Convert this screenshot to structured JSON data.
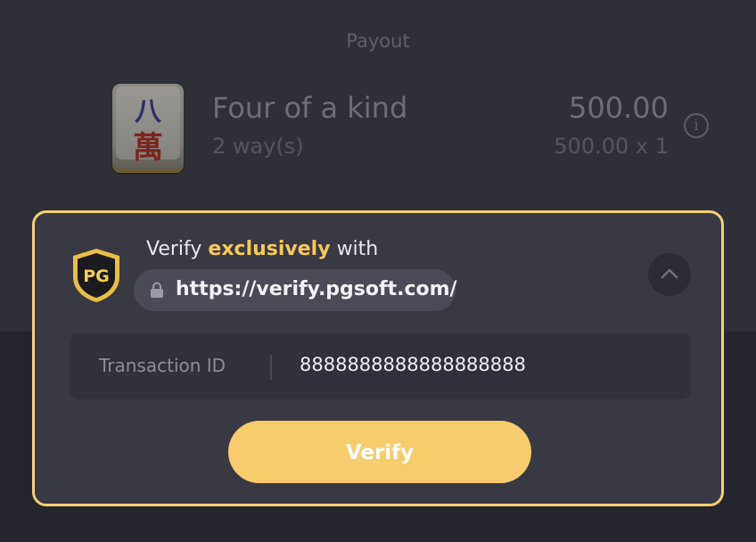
{
  "payout": {
    "title": "Payout",
    "tile": {
      "top_glyph": "八",
      "bottom_glyph": "萬"
    },
    "name": "Four of a kind",
    "ways": "2 way(s)",
    "amount": "500.00",
    "calculation": "500.00 x 1",
    "info_icon": "info-icon"
  },
  "verify_card": {
    "logo_text": "PG",
    "heading_prefix": "Verify",
    "heading_highlight": "exclusively",
    "heading_suffix": "with",
    "url": "https://verify.pgsoft.com/",
    "transaction_label": "Transaction ID",
    "transaction_value": "8888888888888888888",
    "verify_button": "Verify",
    "colors": {
      "accent": "#f3cf73",
      "button": "#f6cc6c",
      "highlight_text": "#f5c95a",
      "card_bg": "#393944"
    }
  }
}
